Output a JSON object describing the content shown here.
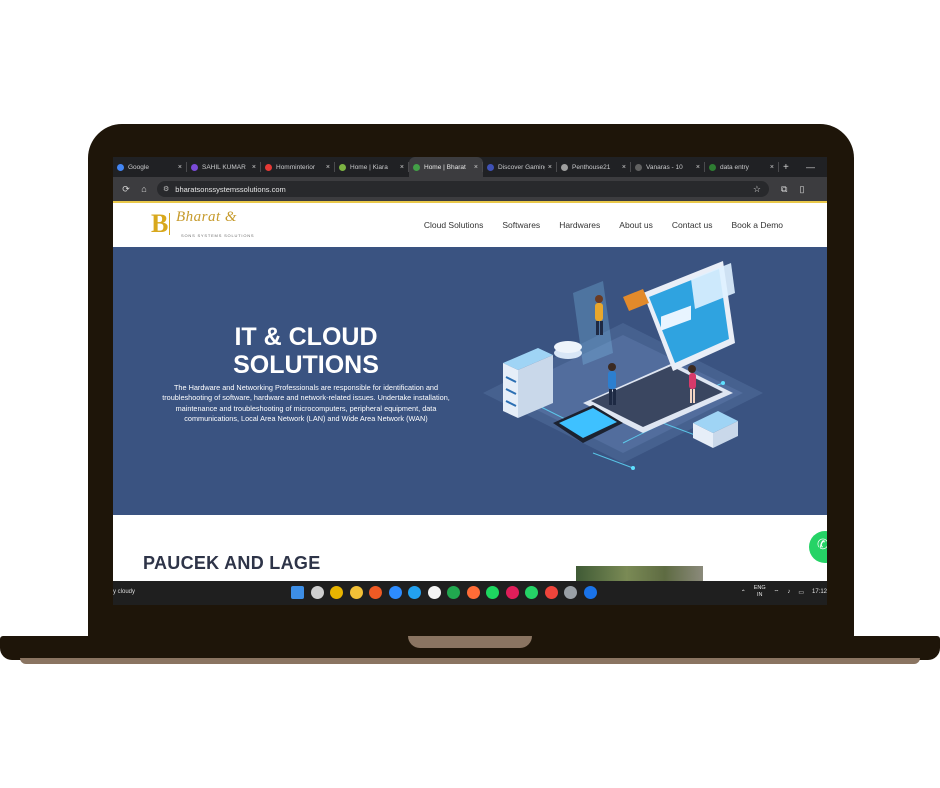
{
  "browser": {
    "tabs": [
      {
        "label": "Google",
        "color": "#4285f4",
        "active": false
      },
      {
        "label": "SAHIL KUMAR",
        "color": "#7b4bd8",
        "active": false
      },
      {
        "label": "Homminterior",
        "color": "#e53935",
        "active": false
      },
      {
        "label": "Home | Kiara",
        "color": "#7cb342",
        "active": false
      },
      {
        "label": "Home | Bharat",
        "color": "#43a047",
        "active": true
      },
      {
        "label": "Discover Gaming",
        "color": "#3f51b5",
        "active": false
      },
      {
        "label": "Penthouse21",
        "color": "#9e9e9e",
        "active": false
      },
      {
        "label": "Vanaras - 10",
        "color": "#616161",
        "active": false
      },
      {
        "label": "data entry",
        "color": "#2e7d32",
        "active": false
      }
    ],
    "close_glyph": "×",
    "newtab_glyph": "+",
    "minimize_glyph": "—",
    "url": "bharatsonssystemssolutions.com"
  },
  "site": {
    "logo_letter": "B",
    "logo_script": "Bharat &",
    "logo_sub": "SONS SYSTEMS SOLUTIONS",
    "nav": [
      "Cloud Solutions",
      "Softwares",
      "Hardwares",
      "About us",
      "Contact us",
      "Book a Demo"
    ],
    "hero": {
      "title_line1": "IT & CLOUD",
      "title_line2": "SOLUTIONS",
      "body": "The Hardware and Networking Professionals are responsible for identification and troubleshooting of software, hardware and network-related issues. Undertake installation, maintenance and troubleshooting of microcomputers, peripheral equipment, data communications, Local Area Network (LAN) and Wide Area Network (WAN)"
    },
    "section2_title": "PAUCEK AND LAGE"
  },
  "taskbar": {
    "weather": "y cloudy",
    "lang_top": "ENG",
    "lang_bottom": "IN",
    "clock": "17:12",
    "icons": [
      {
        "name": "windows-start-icon",
        "color": "#3d8ee6"
      },
      {
        "name": "task-view-icon",
        "color": "#cfcfcf"
      },
      {
        "name": "chrome-icon",
        "color": "#e8b400"
      },
      {
        "name": "file-explorer-icon",
        "color": "#f2c037"
      },
      {
        "name": "brave-icon",
        "color": "#f05a24"
      },
      {
        "name": "zoom-icon",
        "color": "#2d8cff"
      },
      {
        "name": "vscode-icon",
        "color": "#23a1f0"
      },
      {
        "name": "notes-icon",
        "color": "#f4f4f4"
      },
      {
        "name": "mongodb-icon",
        "color": "#21a84f"
      },
      {
        "name": "postman-icon",
        "color": "#ff6c37"
      },
      {
        "name": "spotify-icon",
        "color": "#1ed760"
      },
      {
        "name": "slack-icon",
        "color": "#e01e5a"
      },
      {
        "name": "whatsapp-icon",
        "color": "#25d366"
      },
      {
        "name": "anydesk-icon",
        "color": "#ef443b"
      },
      {
        "name": "settings-icon",
        "color": "#9aa0a6"
      },
      {
        "name": "vpn-icon",
        "color": "#1a73e8"
      }
    ]
  }
}
